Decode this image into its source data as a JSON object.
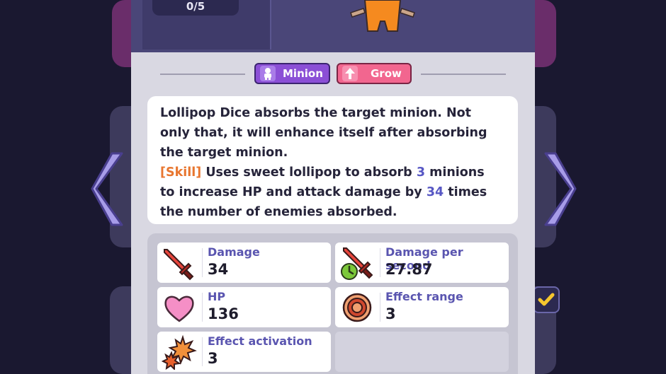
{
  "header": {
    "counter": "0/5"
  },
  "tags": [
    {
      "label": "Minion",
      "color": "#8b4fd6"
    },
    {
      "label": "Grow",
      "color": "#f2668f"
    }
  ],
  "description": {
    "line1": "Lollipop Dice absorbs the target minion. Not",
    "line2": "only that, it will enhance itself after absorbing",
    "line3": "the target minion.",
    "skill_tag": "[Skill]",
    "skill_a": " Uses sweet lollipop to absorb ",
    "skill_num1": "3",
    "skill_b": " minions",
    "line5a": "to increase HP and attack damage by ",
    "skill_num2": "34",
    "line5b": " times",
    "line6": "the number of enemies absorbed."
  },
  "stats": [
    {
      "label": "Damage",
      "value": "34",
      "icon": "sword-icon"
    },
    {
      "label": "Damage per second",
      "value": "27.87",
      "icon": "sword-clock-icon"
    },
    {
      "label": "HP",
      "value": "136",
      "icon": "heart-icon"
    },
    {
      "label": "Effect range",
      "value": "3",
      "icon": "target-icon"
    },
    {
      "label": "Effect activation",
      "value": "3",
      "icon": "burst-icon"
    }
  ],
  "colors": {
    "accent": "#5a55b0",
    "panel": "#d9d8e2",
    "orange": "#e8762f",
    "number": "#5757c4"
  }
}
